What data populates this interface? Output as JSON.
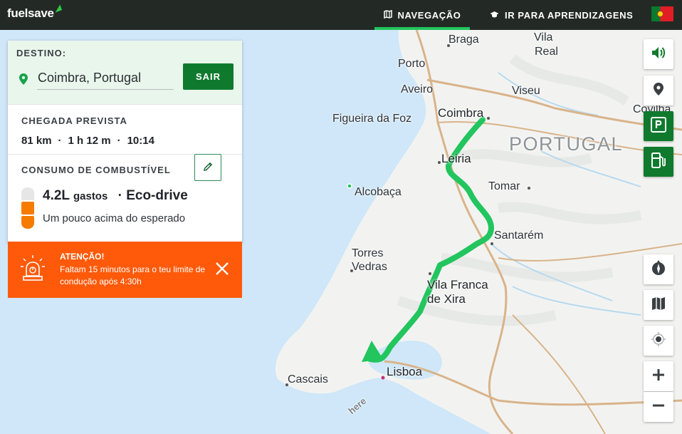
{
  "app": {
    "logo_text": "fuel",
    "logo_text_bold": "save"
  },
  "nav": {
    "items": [
      {
        "label": "NAVEGAÇÃO",
        "icon": "map-icon",
        "active": true
      },
      {
        "label": "IR PARA APRENDIZAGENS",
        "icon": "graduation-cap-icon",
        "active": false
      }
    ],
    "language_flag": "portugal-flag"
  },
  "destination": {
    "label": "DESTINO:",
    "value": "Coimbra, Portugal",
    "exit_label": "SAIR"
  },
  "eta": {
    "label": "CHEGADA PREVISTA",
    "distance": "81 km",
    "duration": "1 h 12 m",
    "arrival_time": "10:14",
    "separator": "·"
  },
  "fuel": {
    "label": "CONSUMO DE COMBUSTÍVEL",
    "amount": "4.2L",
    "amount_unit": "gastos",
    "mode": "· Eco-drive",
    "note": "Um pouco acima do esperado",
    "gauge_level_of_3": 2
  },
  "alert": {
    "title": "ATENÇÃO!",
    "text": "Faltam 15 minutos para o teu limite de condução após 4:30h"
  },
  "map": {
    "labels": [
      "Braga",
      "Vila",
      "Real",
      "Porto",
      "Aveiro",
      "Viseu",
      "Coimbra",
      "Covilha",
      "Figueira da Foz",
      "PORTUGAL",
      "Leiria",
      "Tomar",
      "Alcobaça",
      "Santarém",
      "Torres",
      "Vedras",
      "Vila Franca",
      "de Xira",
      "Cascais",
      "Lisboa"
    ],
    "watermark": "here",
    "colors": {
      "land": "#f1f2ef",
      "water": "#cfe7f8",
      "route": "#22c55e",
      "road": "#d9b38a"
    }
  },
  "controls": [
    "volume-icon",
    "location-pin-icon",
    "parking-icon",
    "fuel-station-icon",
    "compass-icon",
    "map-layers-icon",
    "recenter-icon",
    "zoom-in-icon",
    "zoom-out-icon"
  ]
}
